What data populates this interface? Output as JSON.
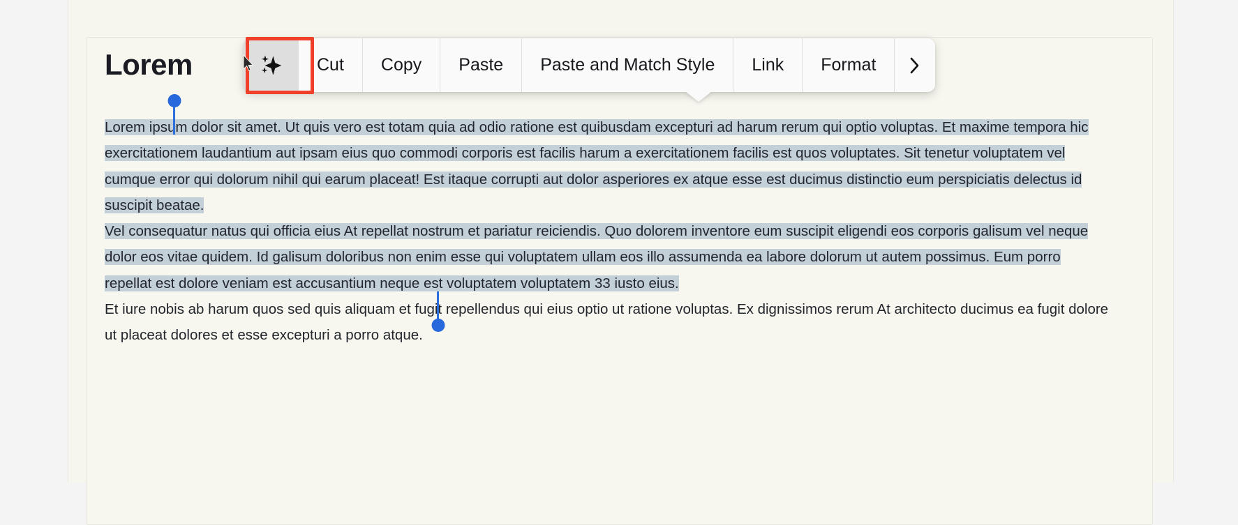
{
  "window": {
    "background_color": "#f4f4f4",
    "page_background_color": "#f6f6ee",
    "card_background_color": "#f7f7ef"
  },
  "document": {
    "heading": "Lorem",
    "paragraphs": [
      {
        "id": "p1",
        "selected": true,
        "text": "Lorem ipsum dolor sit amet. Ut quis vero est totam quia ad odio ratione est quibusdam excepturi ad harum rerum qui optio voluptas. Et maxime tempora hic exercitationem laudantium aut ipsam eius quo commodi corporis est facilis harum a exercitationem facilis est quos voluptates. Sit tenetur voluptatem vel cumque error qui dolorum nihil qui earum placeat! Est itaque corrupti aut dolor asperiores ex atque esse est ducimus distinctio eum perspiciatis delectus id suscipit beatae."
      },
      {
        "id": "p2",
        "selected": true,
        "text": "Vel consequatur natus qui officia eius At repellat nostrum et pariatur reiciendis. Quo dolorem inventore eum suscipit eligendi eos corporis galisum vel neque dolor eos vitae quidem. Id galisum doloribus non enim esse qui voluptatem ullam eos illo assumenda ea labore dolorum ut autem possimus. Eum porro repellat est dolore veniam est accusantium neque est voluptatem voluptatem 33 iusto eius."
      },
      {
        "id": "p3",
        "selected": false,
        "text": "Et iure nobis ab harum quos sed quis aliquam et fugit repellendus qui eius optio ut ratione voluptas. Ex dignissimos rerum At architecto ducimus ea fugit dolore ut placeat dolores et esse excepturi a porro atque."
      }
    ],
    "selection": {
      "active": true,
      "highlight_color": "#c3d0d8",
      "handle_color": "#2769dc"
    }
  },
  "context_toolbar": {
    "items": [
      {
        "id": "ai",
        "label": "✦",
        "icon": "sparkle-icon",
        "hovered": true
      },
      {
        "id": "cut",
        "label": "Cut",
        "icon": null,
        "hovered": false
      },
      {
        "id": "copy",
        "label": "Copy",
        "icon": null,
        "hovered": false
      },
      {
        "id": "paste",
        "label": "Paste",
        "icon": null,
        "hovered": false
      },
      {
        "id": "paste-match-style",
        "label": "Paste and Match Style",
        "icon": null,
        "hovered": false
      },
      {
        "id": "link",
        "label": "Link",
        "icon": null,
        "hovered": false
      },
      {
        "id": "format",
        "label": "Format",
        "icon": null,
        "hovered": false
      },
      {
        "id": "more",
        "label": "›",
        "icon": "chevron-right-icon",
        "hovered": false
      }
    ],
    "background_color": "#fafafa",
    "hover_color": "#dedede",
    "divider_color": "#dedede"
  },
  "annotation": {
    "target_item_id": "ai",
    "border_color": "#f0402a",
    "border_width_px": 5
  }
}
